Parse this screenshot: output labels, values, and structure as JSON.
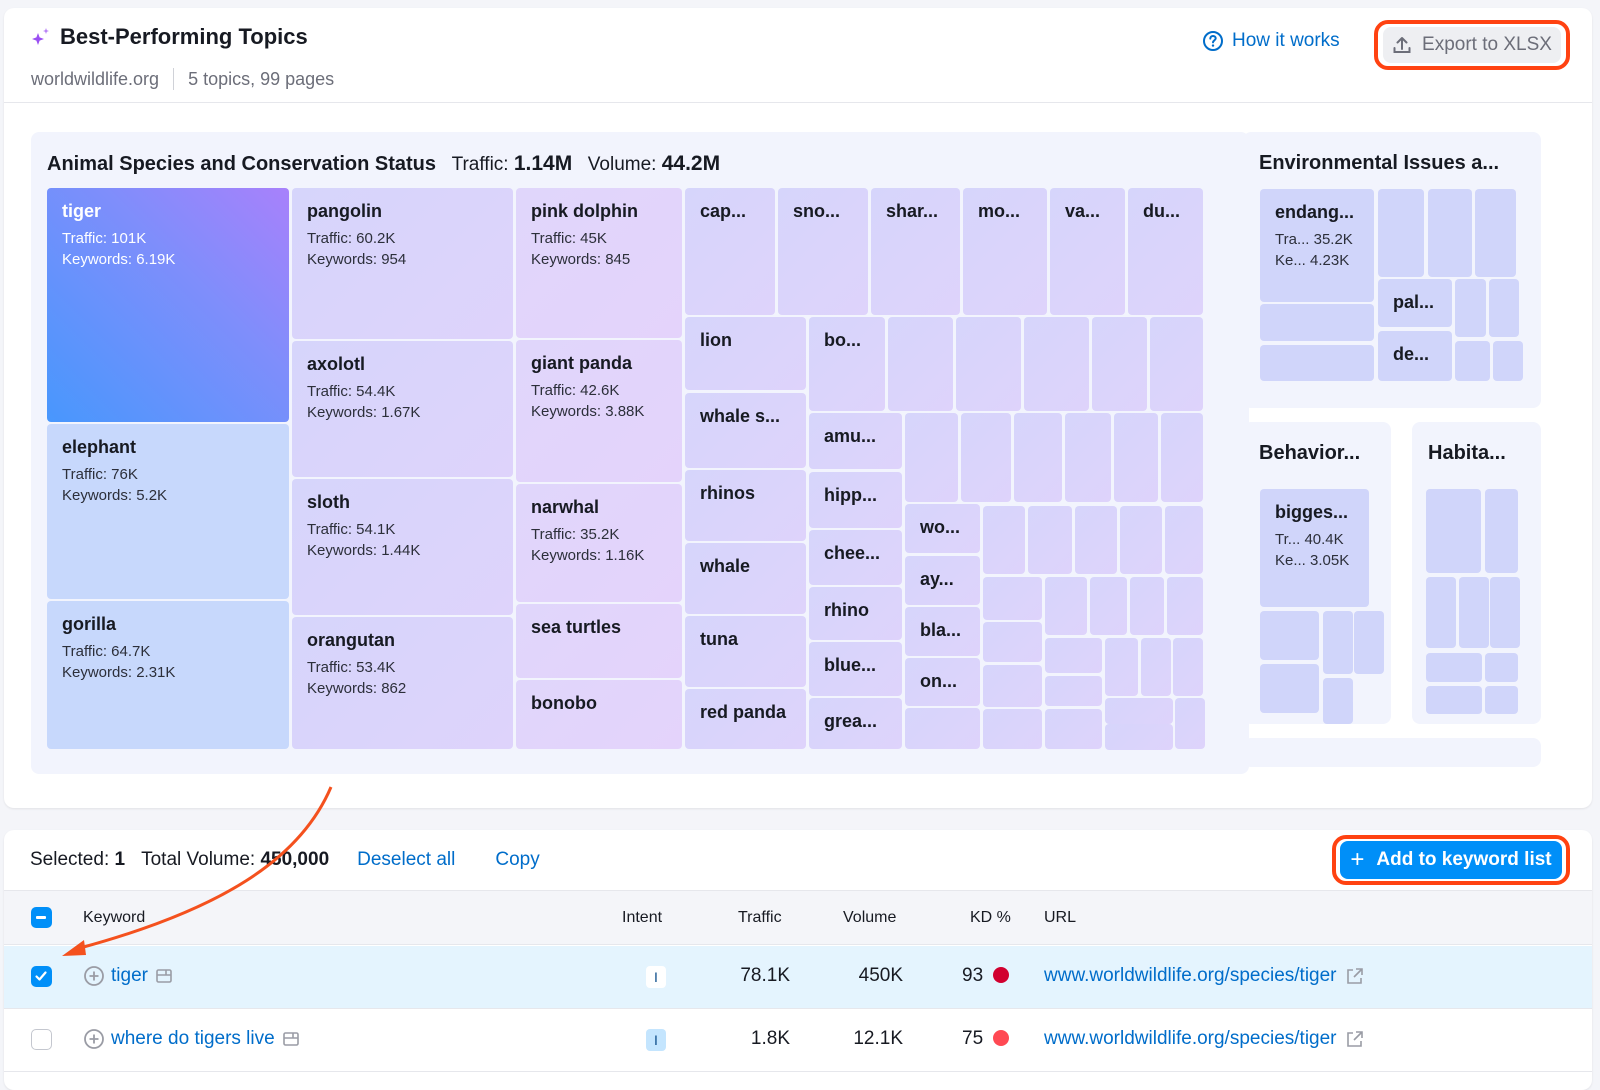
{
  "header": {
    "title": "Best-Performing Topics",
    "title_icon": "sparkle-icon",
    "domain": "worldwildlife.org",
    "summary": "5 topics, 99 pages",
    "how_it_works_label": "How it works",
    "export_label": "Export to XLSX"
  },
  "topics": {
    "main": {
      "title": "Animal Species and Conservation Status",
      "traffic_label": "Traffic:",
      "traffic_value": "1.14M",
      "volume_label": "Volume:",
      "volume_value": "44.2M",
      "cells": [
        {
          "name": "tiger",
          "traffic": "Traffic: 101K",
          "keywords": "Keywords: 6.19K",
          "selected": true
        },
        {
          "name": "elephant",
          "traffic": "Traffic: 76K",
          "keywords": "Keywords: 5.2K"
        },
        {
          "name": "gorilla",
          "traffic": "Traffic: 64.7K",
          "keywords": "Keywords: 2.31K"
        },
        {
          "name": "pangolin",
          "traffic": "Traffic: 60.2K",
          "keywords": "Keywords: 954"
        },
        {
          "name": "axolotl",
          "traffic": "Traffic: 54.4K",
          "keywords": "Keywords: 1.67K"
        },
        {
          "name": "sloth",
          "traffic": "Traffic: 54.1K",
          "keywords": "Keywords: 1.44K"
        },
        {
          "name": "orangutan",
          "traffic": "Traffic: 53.4K",
          "keywords": "Keywords: 862"
        },
        {
          "name": "pink dolphin",
          "traffic": "Traffic: 45K",
          "keywords": "Keywords: 845"
        },
        {
          "name": "giant panda",
          "traffic": "Traffic: 42.6K",
          "keywords": "Keywords: 3.88K"
        },
        {
          "name": "narwhal",
          "traffic": "Traffic: 35.2K",
          "keywords": "Keywords: 1.16K"
        },
        {
          "name": "sea turtles"
        },
        {
          "name": "bonobo"
        },
        {
          "name": "cap..."
        },
        {
          "name": "sno..."
        },
        {
          "name": "shar..."
        },
        {
          "name": "mo..."
        },
        {
          "name": "va..."
        },
        {
          "name": "du..."
        },
        {
          "name": "lion"
        },
        {
          "name": "whale s..."
        },
        {
          "name": "rhinos"
        },
        {
          "name": "whale"
        },
        {
          "name": "tuna"
        },
        {
          "name": "red panda"
        },
        {
          "name": "bo..."
        },
        {
          "name": "amu..."
        },
        {
          "name": "hipp..."
        },
        {
          "name": "chee..."
        },
        {
          "name": "rhino"
        },
        {
          "name": "blue..."
        },
        {
          "name": "grea..."
        },
        {
          "name": "wo..."
        },
        {
          "name": "ay..."
        },
        {
          "name": "bla..."
        },
        {
          "name": "on..."
        }
      ]
    },
    "environmental": {
      "title": "Environmental Issues a...",
      "cells": [
        {
          "name": "endang...",
          "traffic": "Tra...  35.2K",
          "keywords": "Ke...   4.23K"
        },
        {
          "name": "pal..."
        },
        {
          "name": "de..."
        }
      ]
    },
    "behavior": {
      "title": "Behavior...",
      "cells": [
        {
          "name": "bigges...",
          "traffic": "Tr...  40.4K",
          "keywords": "Ke... 3.05K"
        }
      ]
    },
    "habitat": {
      "title": "Habita..."
    }
  },
  "selection": {
    "selected_label": "Selected:",
    "selected_count": "1",
    "total_volume_label": "Total Volume:",
    "total_volume_value": "450,000",
    "deselect_label": "Deselect all",
    "copy_label": "Copy",
    "add_label": "Add to keyword list"
  },
  "table": {
    "columns": [
      "Keyword",
      "Intent",
      "Traffic",
      "Volume",
      "KD %",
      "URL"
    ],
    "rows": [
      {
        "keyword": "tiger",
        "intent": "I",
        "traffic": "78.1K",
        "volume": "450K",
        "kd": "93",
        "kd_color": "#d1002f",
        "url": "www.worldwildlife.org/species/tiger",
        "checked": true
      },
      {
        "keyword": "where do tigers live",
        "intent": "I",
        "traffic": "1.8K",
        "volume": "12.1K",
        "kd": "75",
        "kd_color": "#ff4953",
        "url": "www.worldwildlife.org/species/tiger",
        "checked": false
      }
    ]
  },
  "colors": {
    "accent_blue": "#008ff8",
    "link_blue": "#006dca",
    "highlight_orange": "#ff4211"
  }
}
